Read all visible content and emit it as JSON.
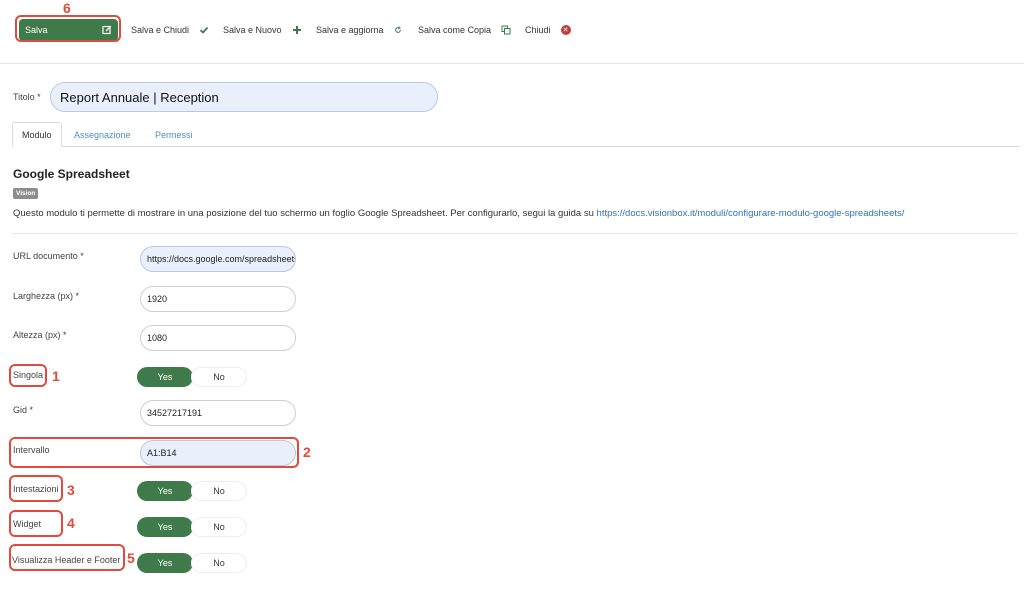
{
  "toolbar": {
    "save": "Salva",
    "save_close": "Salva e Chiudi",
    "save_new": "Salva e Nuovo",
    "save_refresh": "Salva e aggiorna",
    "save_copy": "Salva come Copia",
    "close": "Chiudi"
  },
  "title": {
    "label": "Titolo *",
    "value": "Report Annuale | Reception"
  },
  "tabs": [
    {
      "label": "Modulo",
      "active": true
    },
    {
      "label": "Assegnazione",
      "active": false
    },
    {
      "label": "Permessi",
      "active": false
    }
  ],
  "module": {
    "heading": "Google Spreadsheet",
    "badge": "Vision",
    "description": "Questo modulo ti permette di mostrare in una posizione del tuo schermo un foglio Google Spreadsheet. Per configurarlo, segui la guida su",
    "link": "https://docs.visionbox.it/moduli/configurare-modulo-google-spreadsheets/"
  },
  "form": {
    "url": {
      "label": "URL documento *",
      "value": "https://docs.google.com/spreadsheets"
    },
    "width": {
      "label": "Larghezza (px) *",
      "value": "1920"
    },
    "height": {
      "label": "Altezza (px) *",
      "value": "1080"
    },
    "single": {
      "label": "Singola",
      "yes": "Yes",
      "no": "No"
    },
    "gid": {
      "label": "Gid *",
      "value": "34527217191"
    },
    "range": {
      "label": "Intervallo",
      "value": "A1:B14"
    },
    "headers": {
      "label": "Intestazioni",
      "yes": "Yes",
      "no": "No"
    },
    "widget": {
      "label": "Widget",
      "yes": "Yes",
      "no": "No"
    },
    "header_footer": {
      "label": "Visualizza Header e Footer",
      "yes": "Yes",
      "no": "No"
    }
  },
  "annotations": [
    "1",
    "2",
    "3",
    "4",
    "5",
    "6"
  ],
  "colors": {
    "primary": "#3f7b4a",
    "annotation": "#e24a3d",
    "link": "#2f73b8",
    "danger": "#c43d3a"
  },
  "icons": {
    "save": "edit-icon",
    "save_close": "check-icon",
    "save_new": "plus-icon",
    "save_refresh": "refresh-icon",
    "save_copy": "copy-icon",
    "close": "close-circle-icon"
  }
}
